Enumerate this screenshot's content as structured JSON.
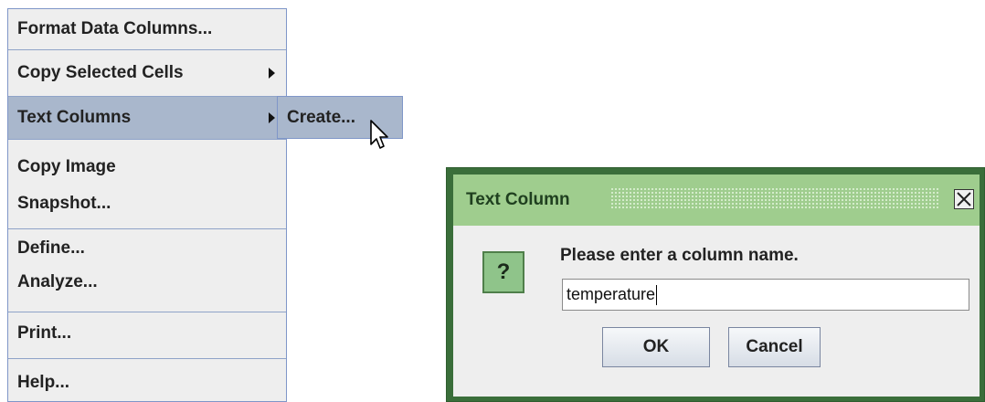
{
  "context_menu": {
    "items": [
      {
        "label": "Format Data Columns..."
      },
      {
        "label": "Copy Selected Cells"
      },
      {
        "label": "Text Columns"
      },
      {
        "label": "Copy Image"
      },
      {
        "label": "Snapshot..."
      },
      {
        "label": "Define..."
      },
      {
        "label": "Analyze..."
      },
      {
        "label": "Print..."
      },
      {
        "label": "Help..."
      }
    ],
    "selected": "Text Columns"
  },
  "submenu": {
    "items": [
      {
        "label": "Create..."
      }
    ]
  },
  "dialog": {
    "title": "Text Column",
    "message": "Please enter a column name.",
    "icon": "?",
    "input_value": "temperature",
    "ok_label": "OK",
    "cancel_label": "Cancel"
  },
  "colors": {
    "menu_bg": "#eeeeee",
    "menu_selected": "#a9b7cc",
    "dialog_frame": "#3a6e3a",
    "dialog_title": "#9fcd8e"
  }
}
